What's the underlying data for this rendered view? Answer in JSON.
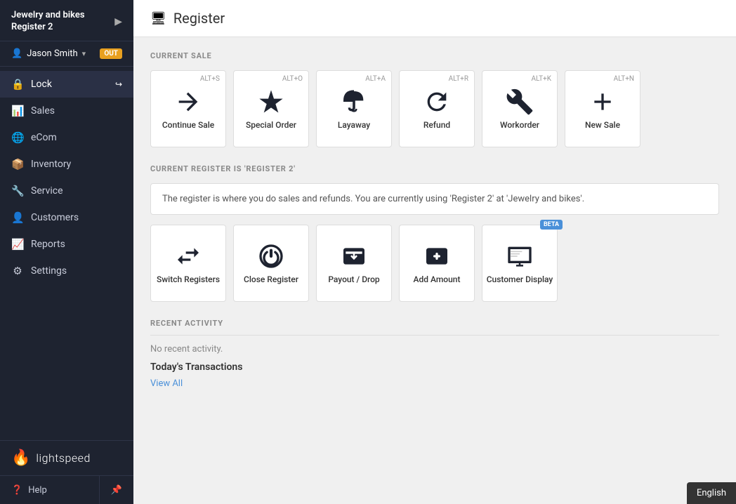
{
  "app": {
    "store_name": "Jewelry and bikes",
    "register_name": "Register 2",
    "user_name": "Jason Smith",
    "out_badge": "OUT"
  },
  "sidebar": {
    "items": [
      {
        "id": "lock",
        "label": "Lock",
        "icon": "lock"
      },
      {
        "id": "sales",
        "label": "Sales",
        "icon": "sales"
      },
      {
        "id": "ecom",
        "label": "eCom",
        "icon": "ecom"
      },
      {
        "id": "inventory",
        "label": "Inventory",
        "icon": "inventory"
      },
      {
        "id": "service",
        "label": "Service",
        "icon": "service"
      },
      {
        "id": "customers",
        "label": "Customers",
        "icon": "customers"
      },
      {
        "id": "reports",
        "label": "Reports",
        "icon": "reports"
      },
      {
        "id": "settings",
        "label": "Settings",
        "icon": "settings"
      }
    ],
    "footer": {
      "help": "Help",
      "logo_text": "lightspeed"
    }
  },
  "header": {
    "title": "Register",
    "icon": "register"
  },
  "current_sale": {
    "section_title": "CURRENT SALE",
    "actions": [
      {
        "id": "continue-sale",
        "label": "Continue Sale",
        "shortcut": "ALT+S"
      },
      {
        "id": "special-order",
        "label": "Special Order",
        "shortcut": "ALT+O"
      },
      {
        "id": "layaway",
        "label": "Layaway",
        "shortcut": "ALT+A"
      },
      {
        "id": "refund",
        "label": "Refund",
        "shortcut": "ALT+R"
      },
      {
        "id": "workorder",
        "label": "Workorder",
        "shortcut": "ALT+K"
      },
      {
        "id": "new-sale",
        "label": "New Sale",
        "shortcut": "ALT+N"
      }
    ]
  },
  "current_register": {
    "section_title": "CURRENT REGISTER IS 'REGISTER 2'",
    "description": "The register is where you do sales and refunds. You are currently using 'Register 2'  at 'Jewelry and bikes'.",
    "actions": [
      {
        "id": "switch-registers",
        "label": "Switch Registers",
        "beta": false
      },
      {
        "id": "close-register",
        "label": "Close Register",
        "beta": false
      },
      {
        "id": "payout-drop",
        "label": "Payout / Drop",
        "beta": false
      },
      {
        "id": "add-amount",
        "label": "Add Amount",
        "beta": false
      },
      {
        "id": "customer-display",
        "label": "Customer Display",
        "beta": true
      }
    ]
  },
  "recent_activity": {
    "section_title": "RECENT ACTIVITY",
    "no_activity": "No recent activity.",
    "todays_transactions": "Today's Transactions",
    "view_all": "View All"
  },
  "footer": {
    "english": "English"
  }
}
